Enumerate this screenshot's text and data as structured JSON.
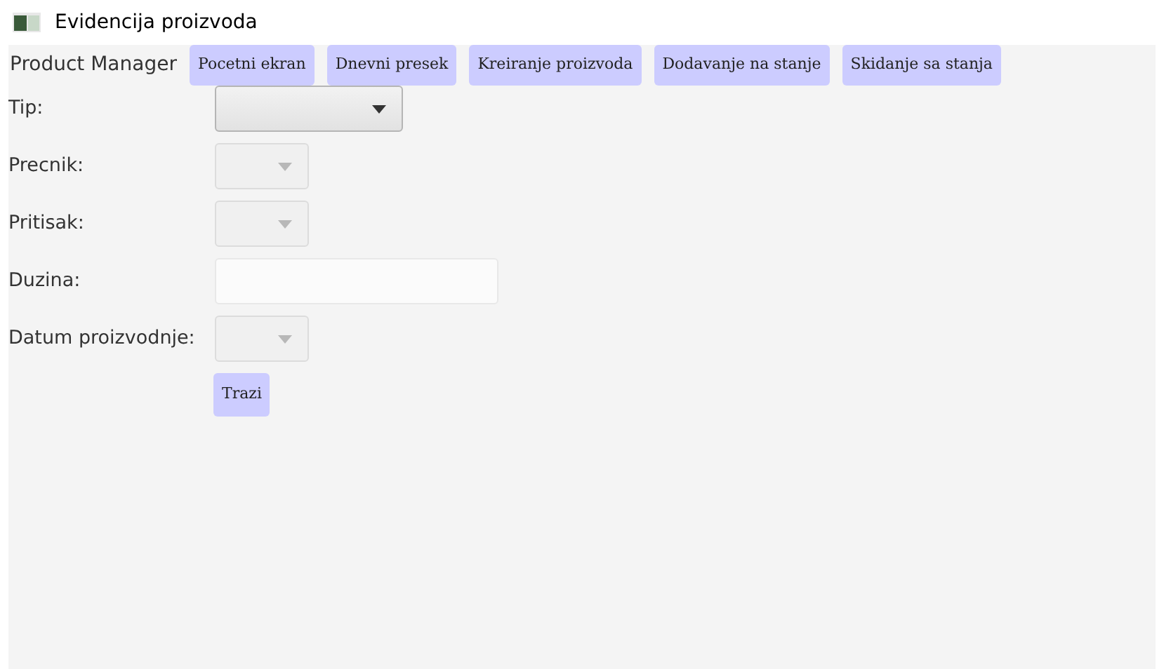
{
  "window": {
    "title": "Evidencija proizvoda"
  },
  "app_name": "Product Manager",
  "nav_buttons": [
    "Pocetni ekran",
    "Dnevni presek",
    "Kreiranje proizvoda",
    "Dodavanje na stanje",
    "Skidanje sa stanja"
  ],
  "form": [
    {
      "label": "Tip:",
      "kind": "combo",
      "disabled": false
    },
    {
      "label": "Precnik:",
      "kind": "combo",
      "disabled": true
    },
    {
      "label": "Pritisak:",
      "kind": "combo",
      "disabled": true
    },
    {
      "label": "Duzina:",
      "kind": "text",
      "disabled": true
    },
    {
      "label": "Datum proizvodnje:",
      "kind": "combo",
      "disabled": true
    }
  ],
  "search_button": "Trazi"
}
